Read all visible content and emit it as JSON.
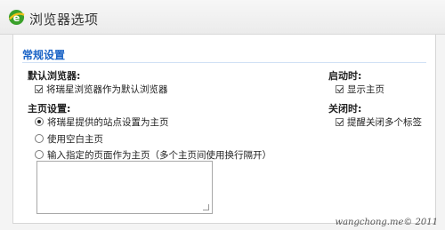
{
  "window": {
    "title": "浏览器选项",
    "logo_icon": "browser-e-icon"
  },
  "section": {
    "title": "常规设置"
  },
  "default_browser": {
    "label": "默认浏览器:",
    "checkbox_label": "将瑞星浏览器作为默认浏览器",
    "checked": true
  },
  "homepage": {
    "label": "主页设置:",
    "options": [
      {
        "label": "将瑞星提供的站点设置为主页",
        "selected": true
      },
      {
        "label": "使用空白主页",
        "selected": false
      },
      {
        "label": "输入指定的页面作为主页（多个主页间使用换行隔开）",
        "selected": false
      }
    ],
    "textarea_value": ""
  },
  "startup": {
    "label": "启动时:",
    "checkbox_label": "显示主页",
    "checked": true
  },
  "on_close": {
    "label": "关闭时:",
    "checkbox_label": "提醒关闭多个标签",
    "checked": true
  },
  "watermark": "wangchong.me© 2011",
  "colors": {
    "accent": "#1a63c6",
    "logo_green": "#3aa02a",
    "logo_yellow": "#f2c21a"
  }
}
